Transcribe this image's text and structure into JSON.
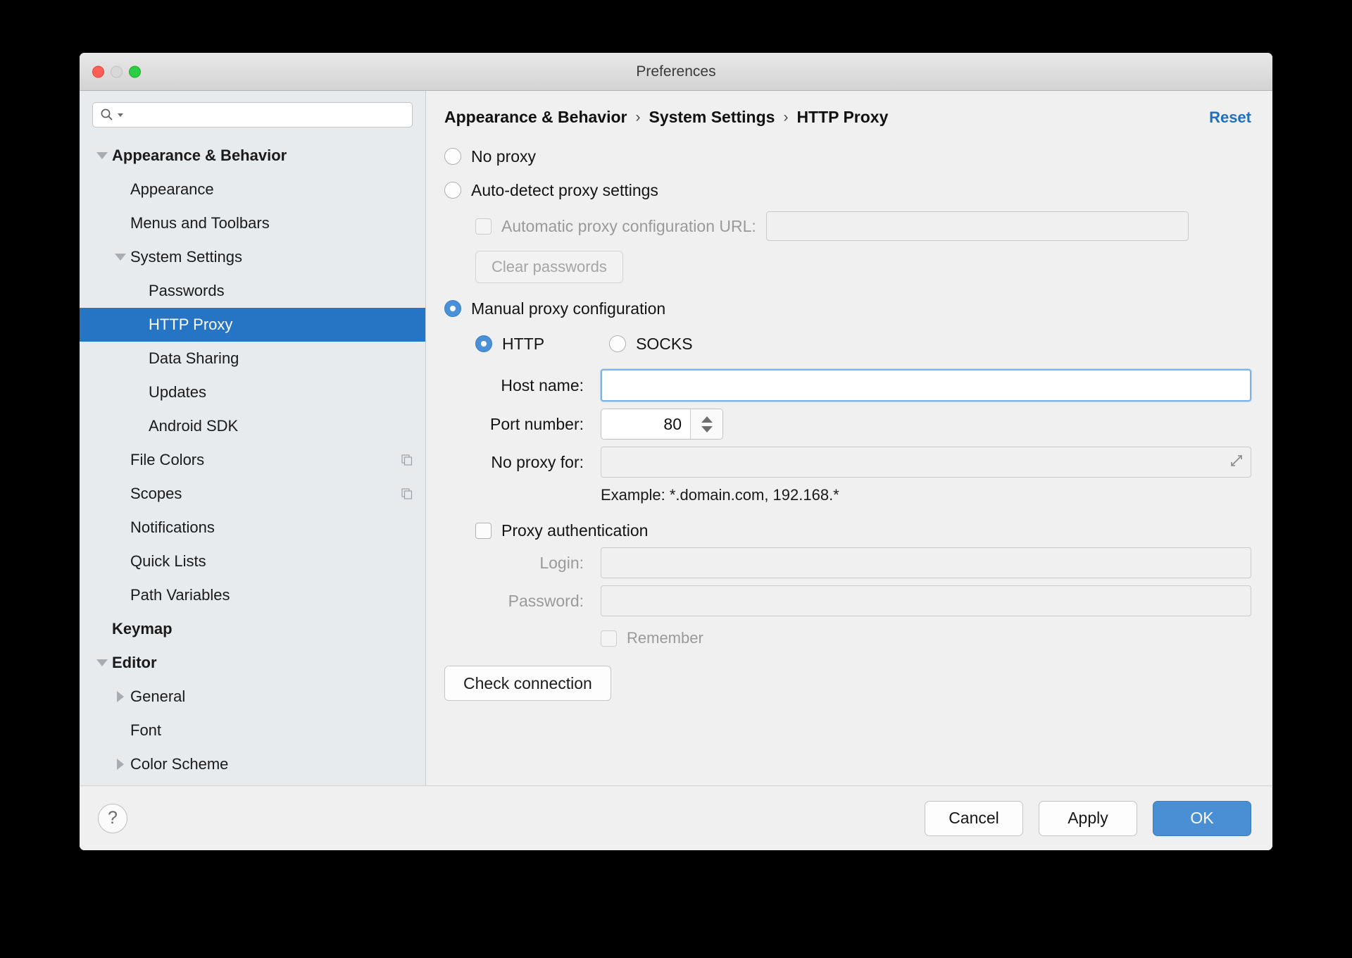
{
  "window": {
    "title": "Preferences",
    "traffic_lights": [
      "close",
      "minimize",
      "maximize"
    ]
  },
  "search": {
    "value": "",
    "placeholder": ""
  },
  "sidebar": {
    "items": [
      {
        "label": "Appearance & Behavior",
        "level": 0,
        "twisty": "down",
        "bold": true,
        "selected": false,
        "icon": ""
      },
      {
        "label": "Appearance",
        "level": 1,
        "twisty": "",
        "bold": false,
        "selected": false,
        "icon": ""
      },
      {
        "label": "Menus and Toolbars",
        "level": 1,
        "twisty": "",
        "bold": false,
        "selected": false,
        "icon": ""
      },
      {
        "label": "System Settings",
        "level": 1,
        "twisty": "down",
        "bold": false,
        "selected": false,
        "icon": ""
      },
      {
        "label": "Passwords",
        "level": 2,
        "twisty": "",
        "bold": false,
        "selected": false,
        "icon": ""
      },
      {
        "label": "HTTP Proxy",
        "level": 2,
        "twisty": "",
        "bold": false,
        "selected": true,
        "icon": ""
      },
      {
        "label": "Data Sharing",
        "level": 2,
        "twisty": "",
        "bold": false,
        "selected": false,
        "icon": ""
      },
      {
        "label": "Updates",
        "level": 2,
        "twisty": "",
        "bold": false,
        "selected": false,
        "icon": ""
      },
      {
        "label": "Android SDK",
        "level": 2,
        "twisty": "",
        "bold": false,
        "selected": false,
        "icon": ""
      },
      {
        "label": "File Colors",
        "level": 1,
        "twisty": "",
        "bold": false,
        "selected": false,
        "icon": "copy-icon"
      },
      {
        "label": "Scopes",
        "level": 1,
        "twisty": "",
        "bold": false,
        "selected": false,
        "icon": "copy-icon"
      },
      {
        "label": "Notifications",
        "level": 1,
        "twisty": "",
        "bold": false,
        "selected": false,
        "icon": ""
      },
      {
        "label": "Quick Lists",
        "level": 1,
        "twisty": "",
        "bold": false,
        "selected": false,
        "icon": ""
      },
      {
        "label": "Path Variables",
        "level": 1,
        "twisty": "",
        "bold": false,
        "selected": false,
        "icon": ""
      },
      {
        "label": "Keymap",
        "level": 0,
        "twisty": "",
        "bold": true,
        "selected": false,
        "icon": ""
      },
      {
        "label": "Editor",
        "level": 0,
        "twisty": "down",
        "bold": true,
        "selected": false,
        "icon": ""
      },
      {
        "label": "General",
        "level": 1,
        "twisty": "right",
        "bold": false,
        "selected": false,
        "icon": ""
      },
      {
        "label": "Font",
        "level": 1,
        "twisty": "",
        "bold": false,
        "selected": false,
        "icon": ""
      },
      {
        "label": "Color Scheme",
        "level": 1,
        "twisty": "right",
        "bold": false,
        "selected": false,
        "icon": ""
      }
    ]
  },
  "main": {
    "breadcrumb": {
      "crumbs": [
        "Appearance & Behavior",
        "System Settings",
        "HTTP Proxy"
      ],
      "separator": "›"
    },
    "reset_label": "Reset",
    "proxy_mode": {
      "no_proxy": {
        "label": "No proxy",
        "checked": false
      },
      "auto_detect": {
        "label": "Auto-detect proxy settings",
        "checked": false
      },
      "manual": {
        "label": "Manual proxy configuration",
        "checked": true
      }
    },
    "pac": {
      "label": "Automatic proxy configuration URL:",
      "checked": false,
      "enabled": false,
      "url_value": ""
    },
    "clear_passwords_label": "Clear passwords",
    "protocol": {
      "http": {
        "label": "HTTP",
        "checked": true
      },
      "socks": {
        "label": "SOCKS",
        "checked": false
      }
    },
    "fields": {
      "host_label": "Host name:",
      "host_value": "",
      "port_label": "Port number:",
      "port_value": "80",
      "no_proxy_label": "No proxy for:",
      "no_proxy_value": "",
      "example_text": "Example: *.domain.com, 192.168.*"
    },
    "auth": {
      "checkbox_label": "Proxy authentication",
      "checked": false,
      "login_label": "Login:",
      "login_value": "",
      "password_label": "Password:",
      "password_value": "",
      "remember_label": "Remember",
      "remember_checked": false
    },
    "check_connection_label": "Check connection"
  },
  "footer": {
    "help_glyph": "?",
    "cancel_label": "Cancel",
    "apply_label": "Apply",
    "ok_label": "OK"
  },
  "colors": {
    "accent": "#2675c4",
    "link": "#2071bd",
    "primary_button": "#4a8fd4",
    "sidebar_bg": "#e7ebee",
    "panel_bg": "#f0f0f0",
    "radio_checked": "#4a90d9",
    "focus_border": "#7eb3e8"
  }
}
